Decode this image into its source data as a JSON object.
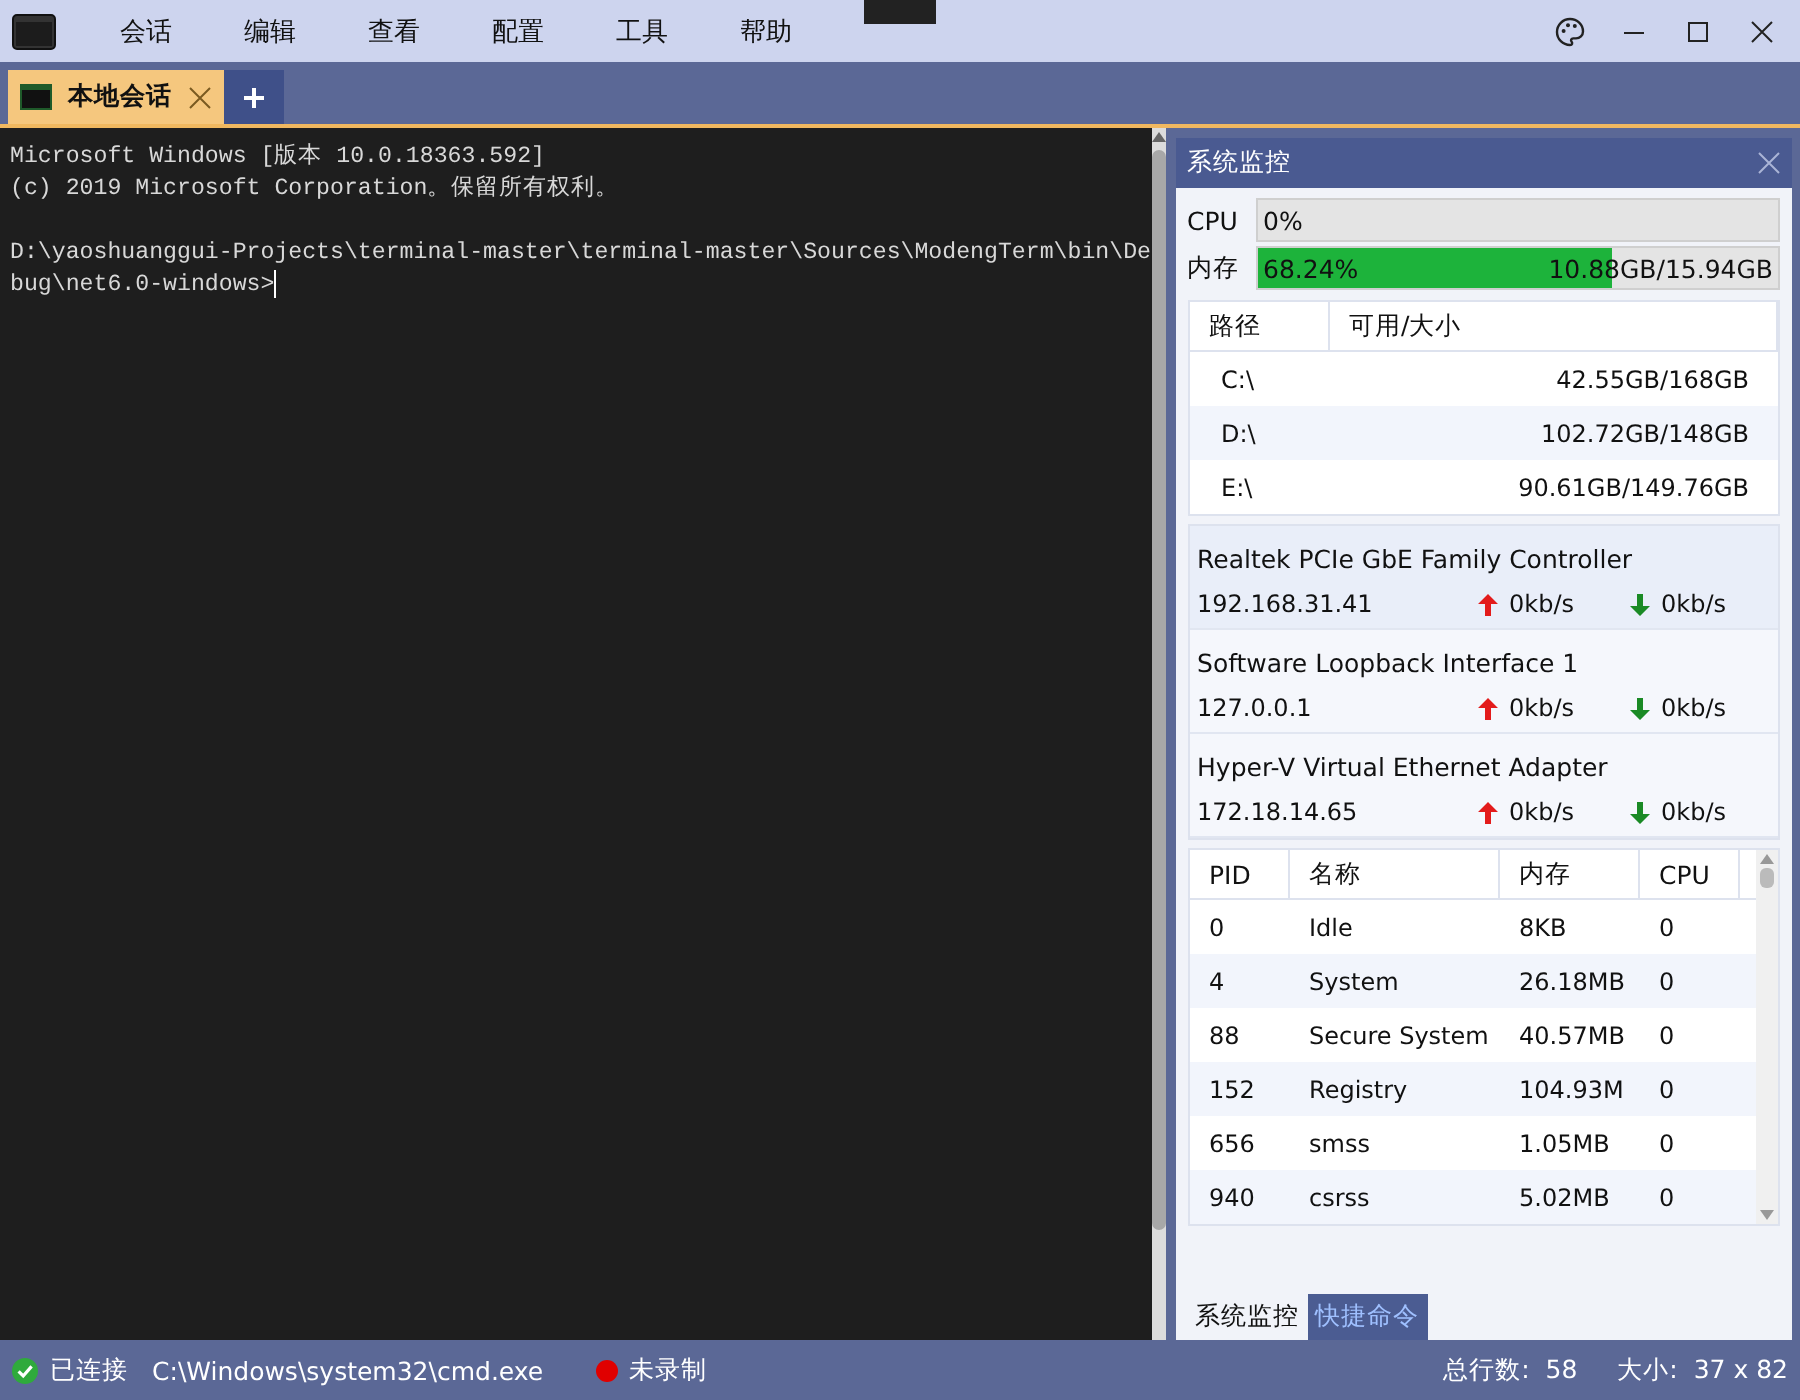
{
  "menu": [
    "会话",
    "编辑",
    "查看",
    "配置",
    "工具",
    "帮助"
  ],
  "tabs": [
    {
      "label": "本地会话",
      "selected": true
    }
  ],
  "terminal": {
    "blocks": [
      [
        "Microsoft Windows [版本 10.0.18363.592]",
        "(c) 2019 Microsoft Corporation。保留所有权利。"
      ],
      [
        "D:\\yaoshuanggui-Projects\\terminal-master\\terminal-master\\Sources\\ModengTerm\\bin\\De",
        "bug\\net6.0-windows>"
      ]
    ]
  },
  "monitor": {
    "title": "系统监控",
    "cpu": {
      "label": "CPU",
      "text": "0%",
      "level": 0
    },
    "memory": {
      "label": "内存",
      "text": "68.24%",
      "detail": "10.88GB/15.94GB",
      "level": 0.6824
    },
    "disks": {
      "columns": [
        "路径",
        "可用/大小"
      ],
      "rows": [
        {
          "path": "C:\\",
          "size": "42.55GB/168GB"
        },
        {
          "path": "D:\\",
          "size": "102.72GB/148GB"
        },
        {
          "path": "E:\\",
          "size": "90.61GB/149.76GB"
        }
      ]
    },
    "adapters": [
      {
        "name": "Realtek PCIe GbE Family Controller",
        "ip": "192.168.31.41",
        "up": "0kb/s",
        "down": "0kb/s",
        "selected": true
      },
      {
        "name": "Software Loopback Interface 1",
        "ip": "127.0.0.1",
        "up": "0kb/s",
        "down": "0kb/s",
        "selected": false
      },
      {
        "name": "Hyper-V Virtual Ethernet Adapter",
        "ip": "172.18.14.65",
        "up": "0kb/s",
        "down": "0kb/s",
        "selected": false
      }
    ],
    "processes": {
      "columns": [
        "PID",
        "名称",
        "内存",
        "CPU"
      ],
      "rows": [
        [
          "0",
          "Idle",
          "8KB",
          "0"
        ],
        [
          "4",
          "System",
          "26.18MB",
          "0"
        ],
        [
          "88",
          "Secure System",
          "40.57MB",
          "0"
        ],
        [
          "152",
          "Registry",
          "104.93M",
          "0"
        ],
        [
          "656",
          "smss",
          "1.05MB",
          "0"
        ],
        [
          "940",
          "csrss",
          "5.02MB",
          "0"
        ]
      ]
    },
    "tabs": [
      {
        "label": "系统监控",
        "selected": true
      },
      {
        "label": "快捷命令",
        "selected": false
      }
    ]
  },
  "status": {
    "connected": true,
    "connection": "已连接",
    "path": "C:\\Windows\\system32\\cmd.exe",
    "recording": false,
    "record": "未录制",
    "lines": "总行数:  58",
    "size": "大小:  37 x 82"
  }
}
